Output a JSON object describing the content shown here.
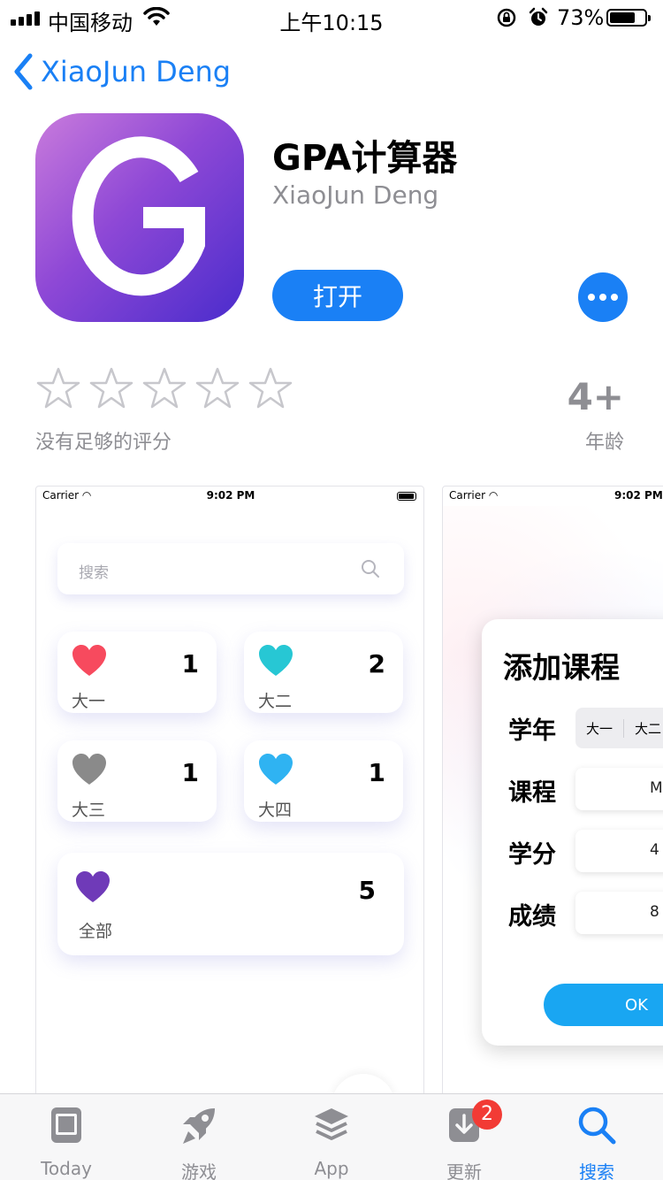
{
  "status_bar": {
    "carrier": "中国移动",
    "time": "上午10:15",
    "battery_pct": "73%",
    "battery_level": 0.73
  },
  "nav": {
    "back_label": "XiaoJun Deng"
  },
  "app": {
    "name": "GPA计算器",
    "developer": "XiaoJun Deng",
    "icon_letter": "G",
    "open_label": "打开",
    "more_icon": "ellipsis-icon"
  },
  "rating": {
    "stars_filled": 0,
    "stars_total": 5,
    "note": "没有足够的评分",
    "age": "4+",
    "age_label": "年龄"
  },
  "screenshot1": {
    "carrier": "Carrier",
    "time": "9:02 PM",
    "search_placeholder": "搜索",
    "cards": [
      {
        "label": "大一",
        "count": "1",
        "color": "#f74a5e"
      },
      {
        "label": "大二",
        "count": "2",
        "color": "#27c7d4"
      },
      {
        "label": "大三",
        "count": "1",
        "color": "#8a8a8a"
      },
      {
        "label": "大四",
        "count": "1",
        "color": "#2fb3f2"
      },
      {
        "label": "全部",
        "count": "5",
        "color": "#6f3ab8"
      }
    ]
  },
  "screenshot2": {
    "carrier": "Carrier",
    "time": "9:02 PM",
    "title": "添加课程",
    "year_label": "学年",
    "year_options": [
      "大一",
      "大二"
    ],
    "course_label": "课程",
    "course_value": "M",
    "credit_label": "学分",
    "credit_value": "4",
    "grade_label": "成绩",
    "grade_value": "8",
    "ok_label": "OK"
  },
  "tabbar": {
    "tabs": [
      {
        "label": "Today",
        "icon": "today-icon"
      },
      {
        "label": "游戏",
        "icon": "rocket-icon"
      },
      {
        "label": "App",
        "icon": "layers-icon"
      },
      {
        "label": "更新",
        "icon": "download-icon",
        "badge": "2"
      },
      {
        "label": "搜索",
        "icon": "search-icon",
        "active": true
      }
    ]
  },
  "colors": {
    "accent": "#1a80f5",
    "badge": "#f23b35"
  }
}
